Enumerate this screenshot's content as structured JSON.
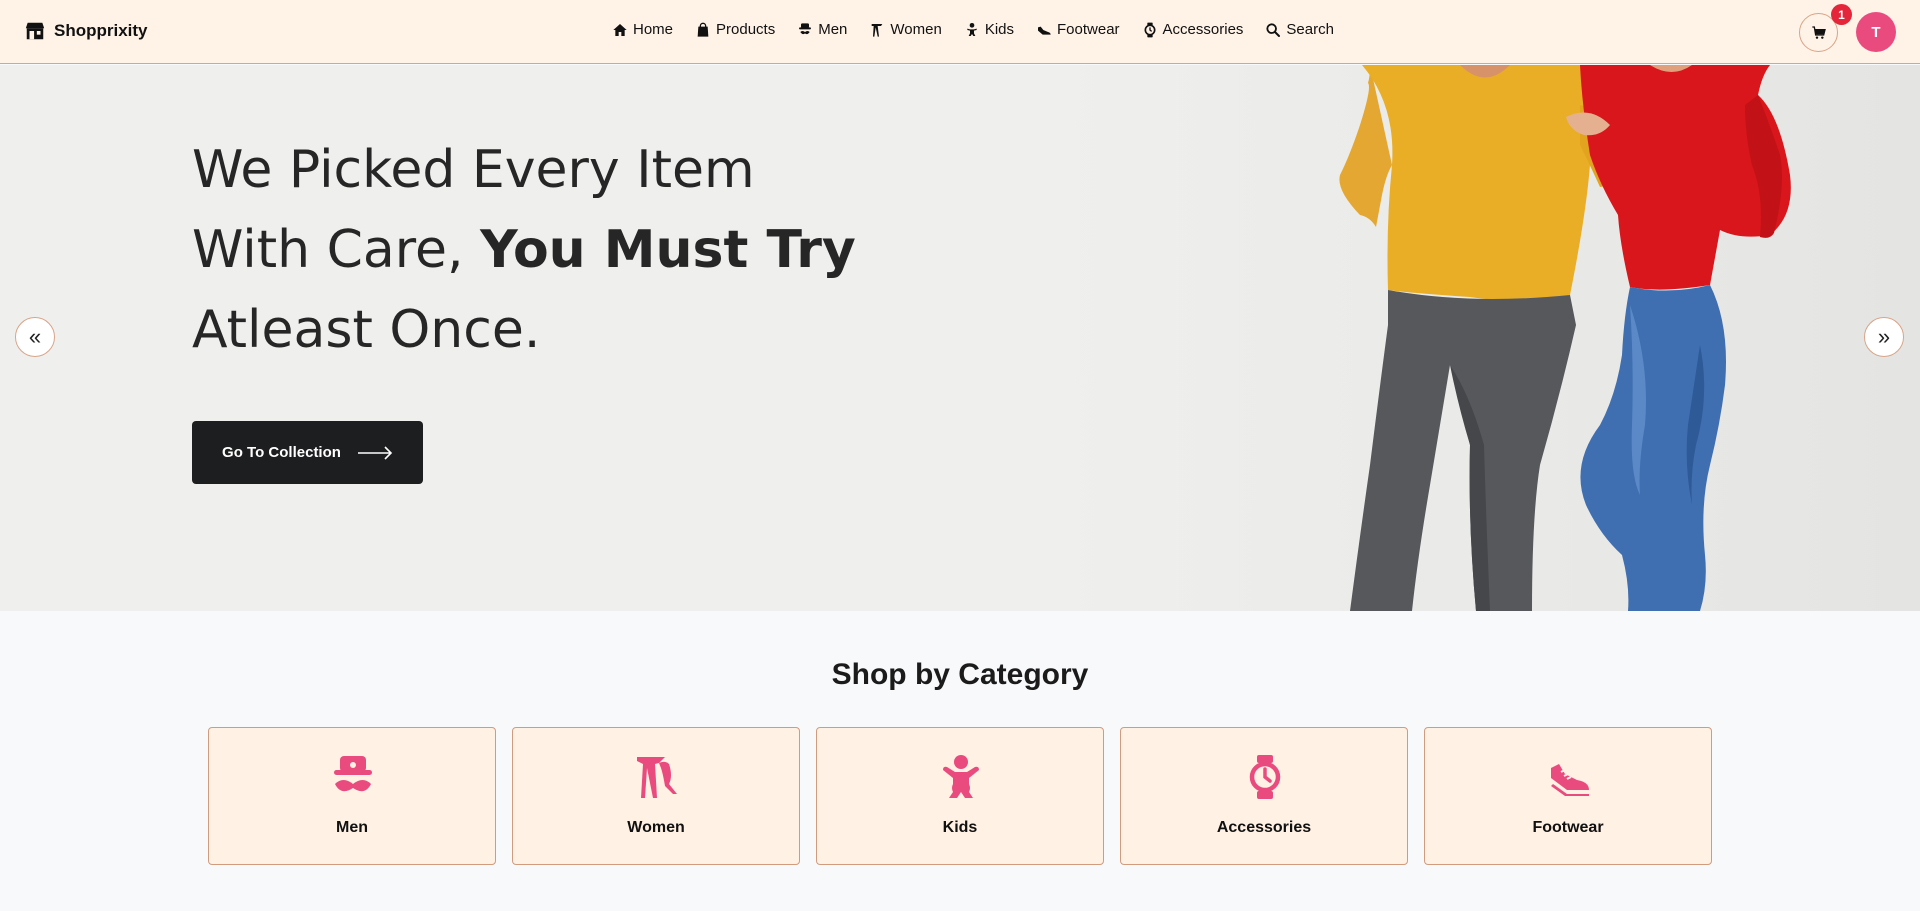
{
  "brand": {
    "name": "Shopprixity"
  },
  "nav": {
    "items": [
      {
        "label": "Home",
        "icon": "home-icon"
      },
      {
        "label": "Products",
        "icon": "shopping-bag-icon"
      },
      {
        "label": "Men",
        "icon": "man-icon"
      },
      {
        "label": "Women",
        "icon": "legs-icon"
      },
      {
        "label": "Kids",
        "icon": "baby-icon"
      },
      {
        "label": "Footwear",
        "icon": "shoe-icon"
      },
      {
        "label": "Accessories",
        "icon": "watch-icon"
      },
      {
        "label": "Search",
        "icon": "search-icon"
      }
    ]
  },
  "cart": {
    "count": "1",
    "icon": "cart-icon"
  },
  "user": {
    "initial": "T"
  },
  "hero": {
    "line1": "We Picked Every Item",
    "line2_plain": "With Care, ",
    "line2_bold": "You Must Try",
    "line3": "Atleast Once.",
    "cta": "Go To Collection",
    "prev_icon": "«",
    "next_icon": "»"
  },
  "categories": {
    "heading": "Shop by Category",
    "items": [
      {
        "label": "Men",
        "icon": "man-icon"
      },
      {
        "label": "Women",
        "icon": "legs-icon"
      },
      {
        "label": "Kids",
        "icon": "baby-icon"
      },
      {
        "label": "Accessories",
        "icon": "watch-icon"
      },
      {
        "label": "Footwear",
        "icon": "shoe-icon"
      }
    ]
  },
  "colors": {
    "accent": "#e94b7f",
    "nav_bg": "#fff3e8",
    "card_bg": "#fff1e4",
    "border": "#d29b7e",
    "badge": "#e5263a",
    "cta_bg": "#1d1e20"
  }
}
